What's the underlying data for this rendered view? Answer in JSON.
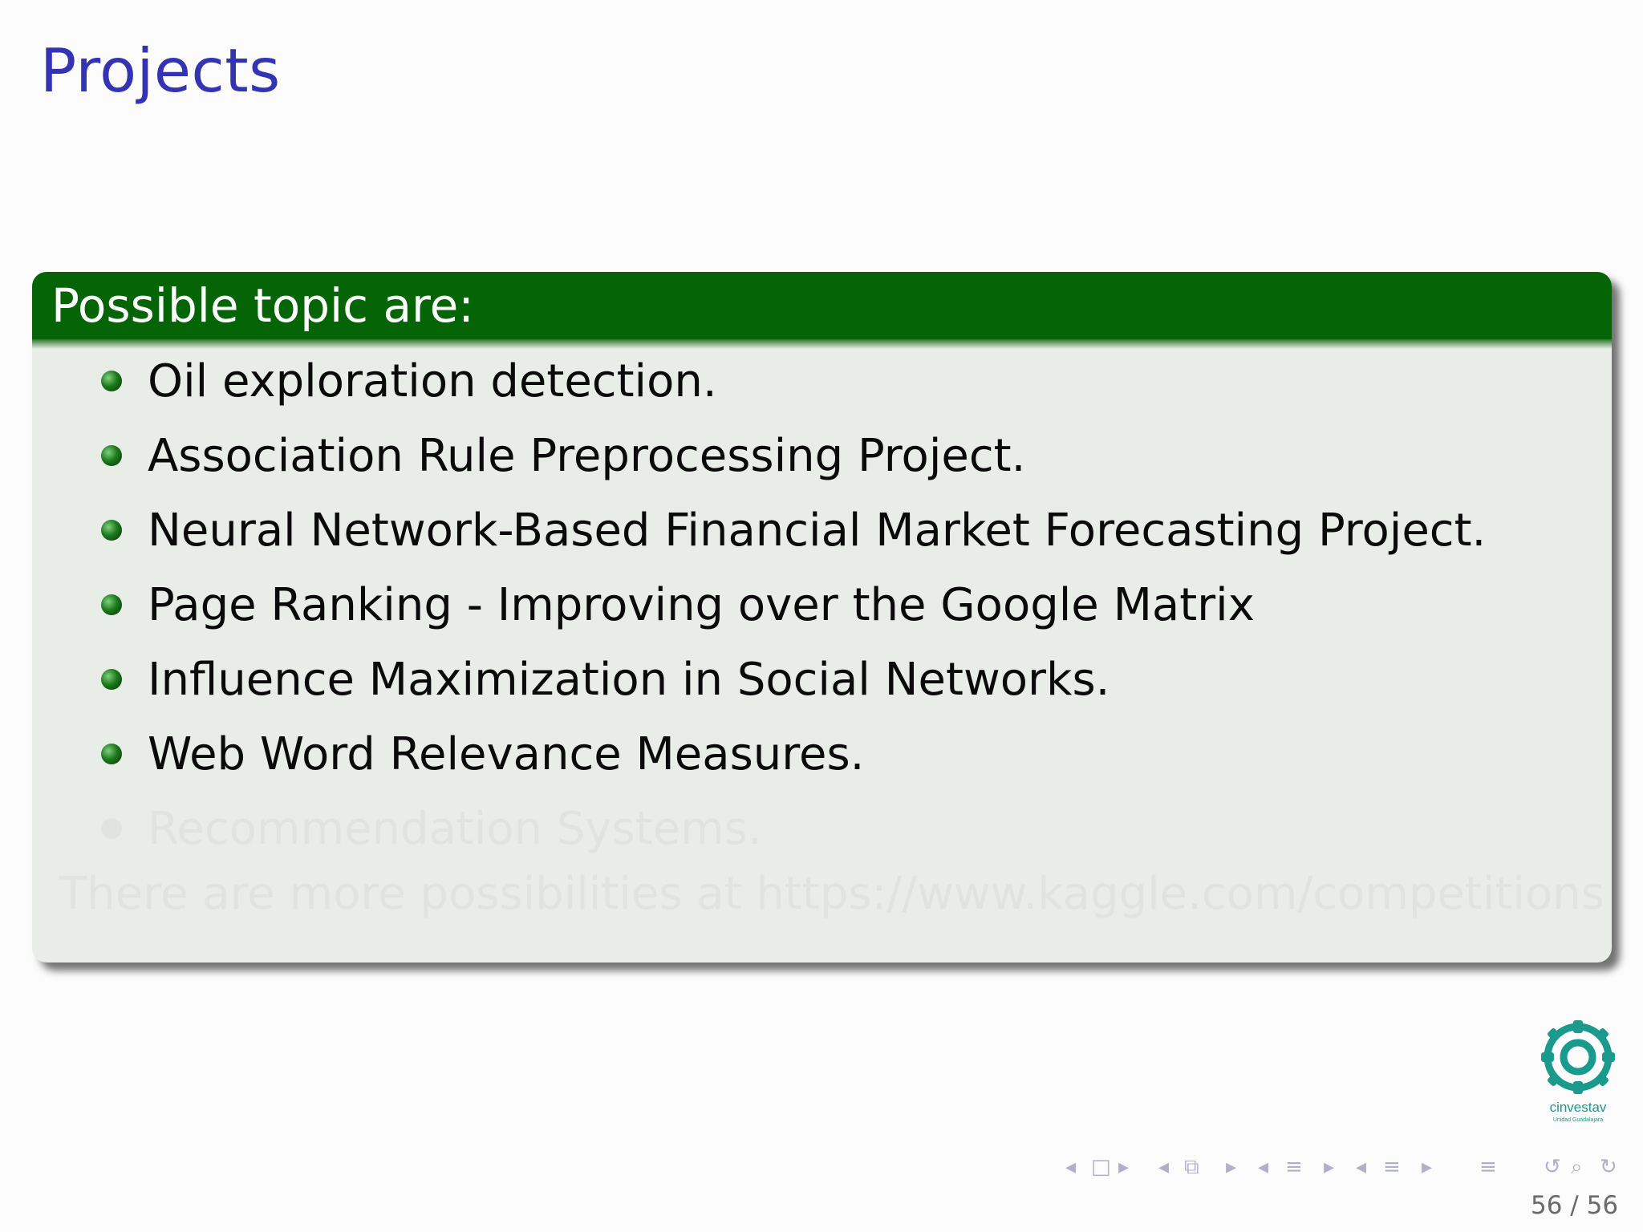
{
  "slide": {
    "title": "Projects"
  },
  "block": {
    "title": "Possible topic are:",
    "items": [
      "Oil exploration detection.",
      "Association Rule Preprocessing Project.",
      "Neural Network-Based Financial Market Forecasting Project.",
      "Page Ranking - Improving over the Google Matrix",
      "Influence Maximization in Social Networks.",
      "Web Word Relevance Measures."
    ],
    "hidden_item": "Recommendation Systems.",
    "hidden_note": "There are more possibilities at https://www.kaggle.com/competitions"
  },
  "logo": {
    "text": "cinvestav",
    "subtext": "Unidad Guadalajara",
    "color": "#1a9a8c"
  },
  "footer": {
    "page_number": "56 / 56"
  },
  "nav_icons": [
    "nav-prev-frame-icon",
    "nav-frame-icon",
    "nav-next-frame-icon",
    "nav-prev-subsection-icon",
    "nav-subsection-icon",
    "nav-next-subsection-icon",
    "nav-prev-section-icon",
    "nav-section-icon",
    "nav-next-section-icon",
    "nav-prev-list-icon",
    "nav-list-icon",
    "nav-next-list-icon",
    "nav-outline-icon",
    "nav-back-icon",
    "nav-search-icon",
    "nav-forward-icon"
  ]
}
